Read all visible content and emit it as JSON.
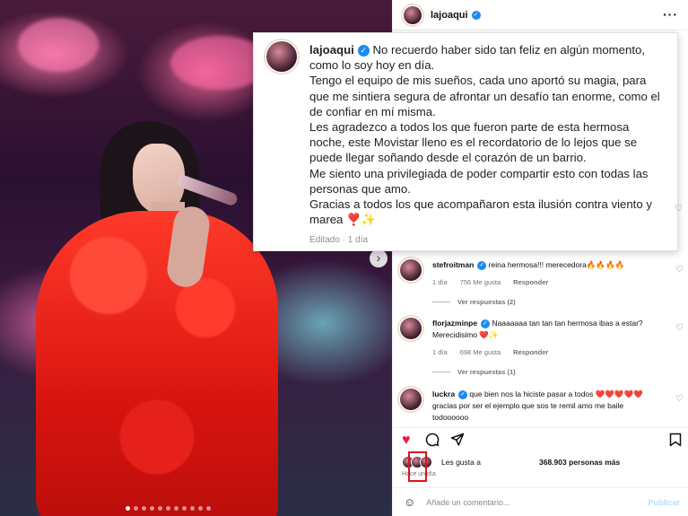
{
  "post": {
    "username": "lajoaqui",
    "more_label": "···",
    "caption_text": "No recuerdo haber sido tan feliz en algún momento, como lo soy hoy en día.\nTengo el equipo de mis sueños, cada uno aportó su magia, para que me sintiera segura de afrontar un desafío tan enorme, como el de confiar en mí misma.\nLes agradezco a todos los que fueron parte de esta hermosa noche, este Movistar lleno es el recordatorio de lo lejos que se puede llegar soñando desde el corazón de un barrio.\nMe siento una privilegiada de poder compartir esto con todas las personas que amo.\nGracias a todos los que acompañaron esta ilusión contra viento y marea ❣️✨",
    "edited": "Editado · 1 día"
  },
  "comments": [
    {
      "username": "stefroitman",
      "text": "reina hermosa!!! merecedora🔥🔥🔥🔥",
      "age": "1 día",
      "likes": "756 Me gusta",
      "reply": "Responder",
      "view_replies": "Ver respuestas (2)"
    },
    {
      "username": "florjazminpe",
      "text": "Naaaaaaa tan tan tan hermosa ibas a estar? Merecidisimo ❤️✨",
      "age": "1 día",
      "likes": "698 Me gusta",
      "reply": "Responder",
      "view_replies": "Ver respuestas (1)"
    },
    {
      "username": "luckra",
      "text": "que bien nos la hiciste pasar a todos ❤️❤️❤️❤️❤️ gracias por ser el ejemplo que sos te remil amo me baile todoooooo"
    }
  ],
  "likes": {
    "label": "Les gusta a",
    "count": "368.903 personas más",
    "time": "Hace un día"
  },
  "composer": {
    "placeholder": "Añade un comentario...",
    "post_label": "Publicar"
  },
  "icons": {
    "like": "heart-icon",
    "comment": "comment-icon",
    "share": "share-icon",
    "save": "bookmark-icon",
    "emoji": "emoji-icon"
  },
  "colors": {
    "like_red": "#ed1c3a",
    "verified_blue": "#1a8cf0",
    "highlight_box": "#d9131b",
    "post_button_disabled": "#b2dffc"
  },
  "carousel": {
    "total_slides": 11,
    "current": 1
  }
}
